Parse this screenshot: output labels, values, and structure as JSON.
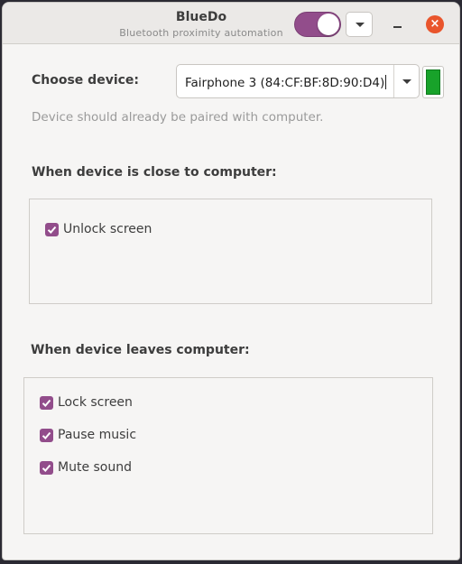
{
  "header": {
    "title": "BlueDo",
    "subtitle": "Bluetooth proximity automation",
    "switch_on": true,
    "close_glyph": "×"
  },
  "device": {
    "label": "Choose device:",
    "selected": "Fairphone 3 (84:CF:BF:8D:90:D4)",
    "hint": "Device should already be paired with computer.",
    "status_color": "#18a22a"
  },
  "close_section": {
    "heading": "When device is close to computer:",
    "actions": [
      {
        "label": "Unlock screen",
        "checked": true
      }
    ]
  },
  "leave_section": {
    "heading": "When device leaves computer:",
    "actions": [
      {
        "label": "Lock screen",
        "checked": true
      },
      {
        "label": "Pause music",
        "checked": true
      },
      {
        "label": "Mute sound",
        "checked": true
      }
    ]
  },
  "colors": {
    "accent": "#924d8b",
    "close_button": "#e9552c"
  }
}
